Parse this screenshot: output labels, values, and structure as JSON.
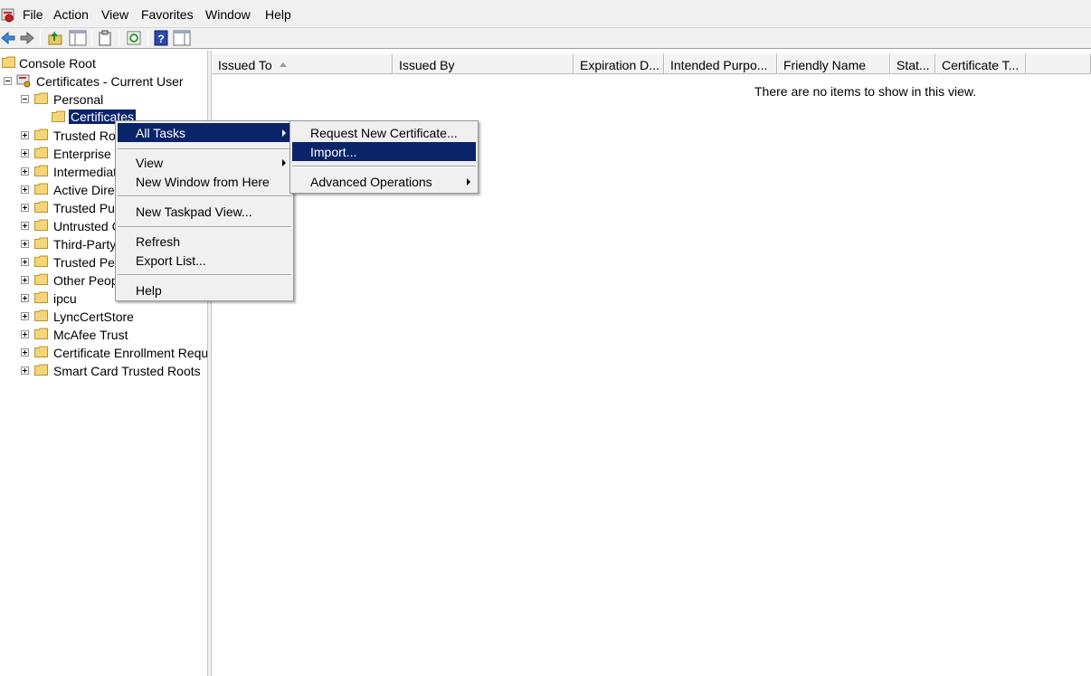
{
  "menubar": {
    "items": [
      "File",
      "Action",
      "View",
      "Favorites",
      "Window",
      "Help"
    ]
  },
  "toolbar": {
    "buttons": [
      "back-icon",
      "forward-icon",
      "up-folder-icon",
      "show-hide-tree-icon",
      "export-list-icon",
      "refresh-icon",
      "help-icon",
      "action-pane-icon"
    ]
  },
  "tree": {
    "console_root": "Console Root",
    "certificates_current_user": "Certificates - Current User",
    "personal": "Personal",
    "certificates": "Certificates",
    "items": [
      "Trusted Ro",
      "Enterprise T",
      "Intermediat",
      "Active Direc",
      "Trusted Pu",
      "Untrusted C",
      "Third-Party",
      "Trusted Pe",
      "Other Peop",
      "ipcu",
      "LyncCertStore",
      "McAfee Trust",
      "Certificate Enrollment Reque",
      "Smart Card Trusted Roots"
    ]
  },
  "list": {
    "columns": [
      "Issued To",
      "Issued By",
      "Expiration D...",
      "Intended Purpo...",
      "Friendly Name",
      "Stat...",
      "Certificate T..."
    ],
    "empty_message": "There are no items to show in this view."
  },
  "context_menu": {
    "all_tasks": "All Tasks",
    "view": "View",
    "new_window": "New Window from Here",
    "new_taskpad": "New Taskpad View...",
    "refresh": "Refresh",
    "export_list": "Export List...",
    "help": "Help"
  },
  "submenu": {
    "request_new_certificate": "Request New Certificate...",
    "import": "Import...",
    "advanced_operations": "Advanced Operations"
  },
  "colors": {
    "selection": "#0a246a",
    "menu_bg": "#f0f0f0",
    "folder": "#f5d57a"
  }
}
